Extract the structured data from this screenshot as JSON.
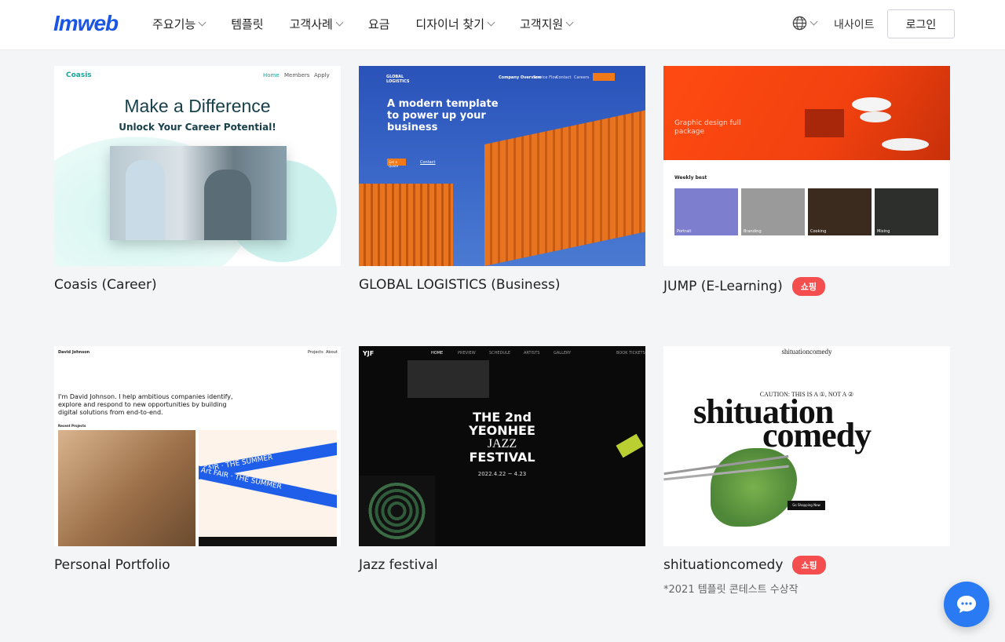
{
  "header": {
    "logo": "Imweb",
    "nav": [
      {
        "label": "주요기능",
        "has_dropdown": true
      },
      {
        "label": "템플릿",
        "has_dropdown": false
      },
      {
        "label": "고객사례",
        "has_dropdown": true
      },
      {
        "label": "요금",
        "has_dropdown": false
      },
      {
        "label": "디자이너 찾기",
        "has_dropdown": true
      },
      {
        "label": "고객지원",
        "has_dropdown": true
      }
    ],
    "language_icon": "globe-icon",
    "mysite_label": "내사이트",
    "login_label": "로그인"
  },
  "templates": [
    {
      "title": "Coasis (Career)",
      "preview": {
        "brand": "Coasis",
        "nav": [
          "Home",
          "Members",
          "Apply"
        ],
        "headline": "Make a Difference",
        "subheadline": "Unlock Your Career Potential!"
      }
    },
    {
      "title": "GLOBAL LOGISTICS (Business)",
      "preview": {
        "brand": "GLOBAL LOGISTICS",
        "nav": [
          "Company Overview",
          "Service Flow",
          "Contact",
          "Careers"
        ],
        "headline": "A modern template to power up your business",
        "btn1": "Get a Quote",
        "btn2": "Contact"
      }
    },
    {
      "title": "JUMP (E-Learning)",
      "badge": "쇼핑",
      "preview": {
        "hero_text": "Graphic design full package",
        "section": "Weekly best",
        "items": [
          "Portrait",
          "Branding",
          "Cooking",
          "Mixing"
        ]
      }
    },
    {
      "title": "Personal Portfolio",
      "preview": {
        "name": "David Johnson",
        "nav": [
          "Projects",
          "About"
        ],
        "intro": "I'm David Johnson. I help ambitious companies identify, explore and respond to new opportunities by building digital solutions from end-to-end.",
        "section": "Recent Projects",
        "tape_text": "Art FAIR · THE SUMMER"
      }
    },
    {
      "title": "Jazz festival",
      "preview": {
        "brand": "YJF",
        "nav": [
          "HOME",
          "PREVIEW",
          "SCHEDULE",
          "ARTISTS",
          "GALLERY",
          "BOOK TICKETS"
        ],
        "line1": "THE 2nd",
        "line2": "YEONHEE",
        "line3": "JAZZ",
        "line4": "FESTIVAL",
        "dates": "2022.4.22 ~ 4.23"
      }
    },
    {
      "title": "shituationcomedy",
      "badge": "쇼핑",
      "subtitle": "*2021 템플릿 콘테스트 수상작",
      "preview": {
        "brand": "shituationcomedy",
        "caution": "CAUTION: THIS IS A ①, NOT A ②",
        "word1": "shituation",
        "word2": "comedy",
        "button": "Go Shopping Now"
      }
    }
  ],
  "chat_icon": "chat-bubble-icon",
  "colors": {
    "brand": "#1a55e3",
    "badge": "#f44e4e",
    "chat": "#2a7af3"
  }
}
